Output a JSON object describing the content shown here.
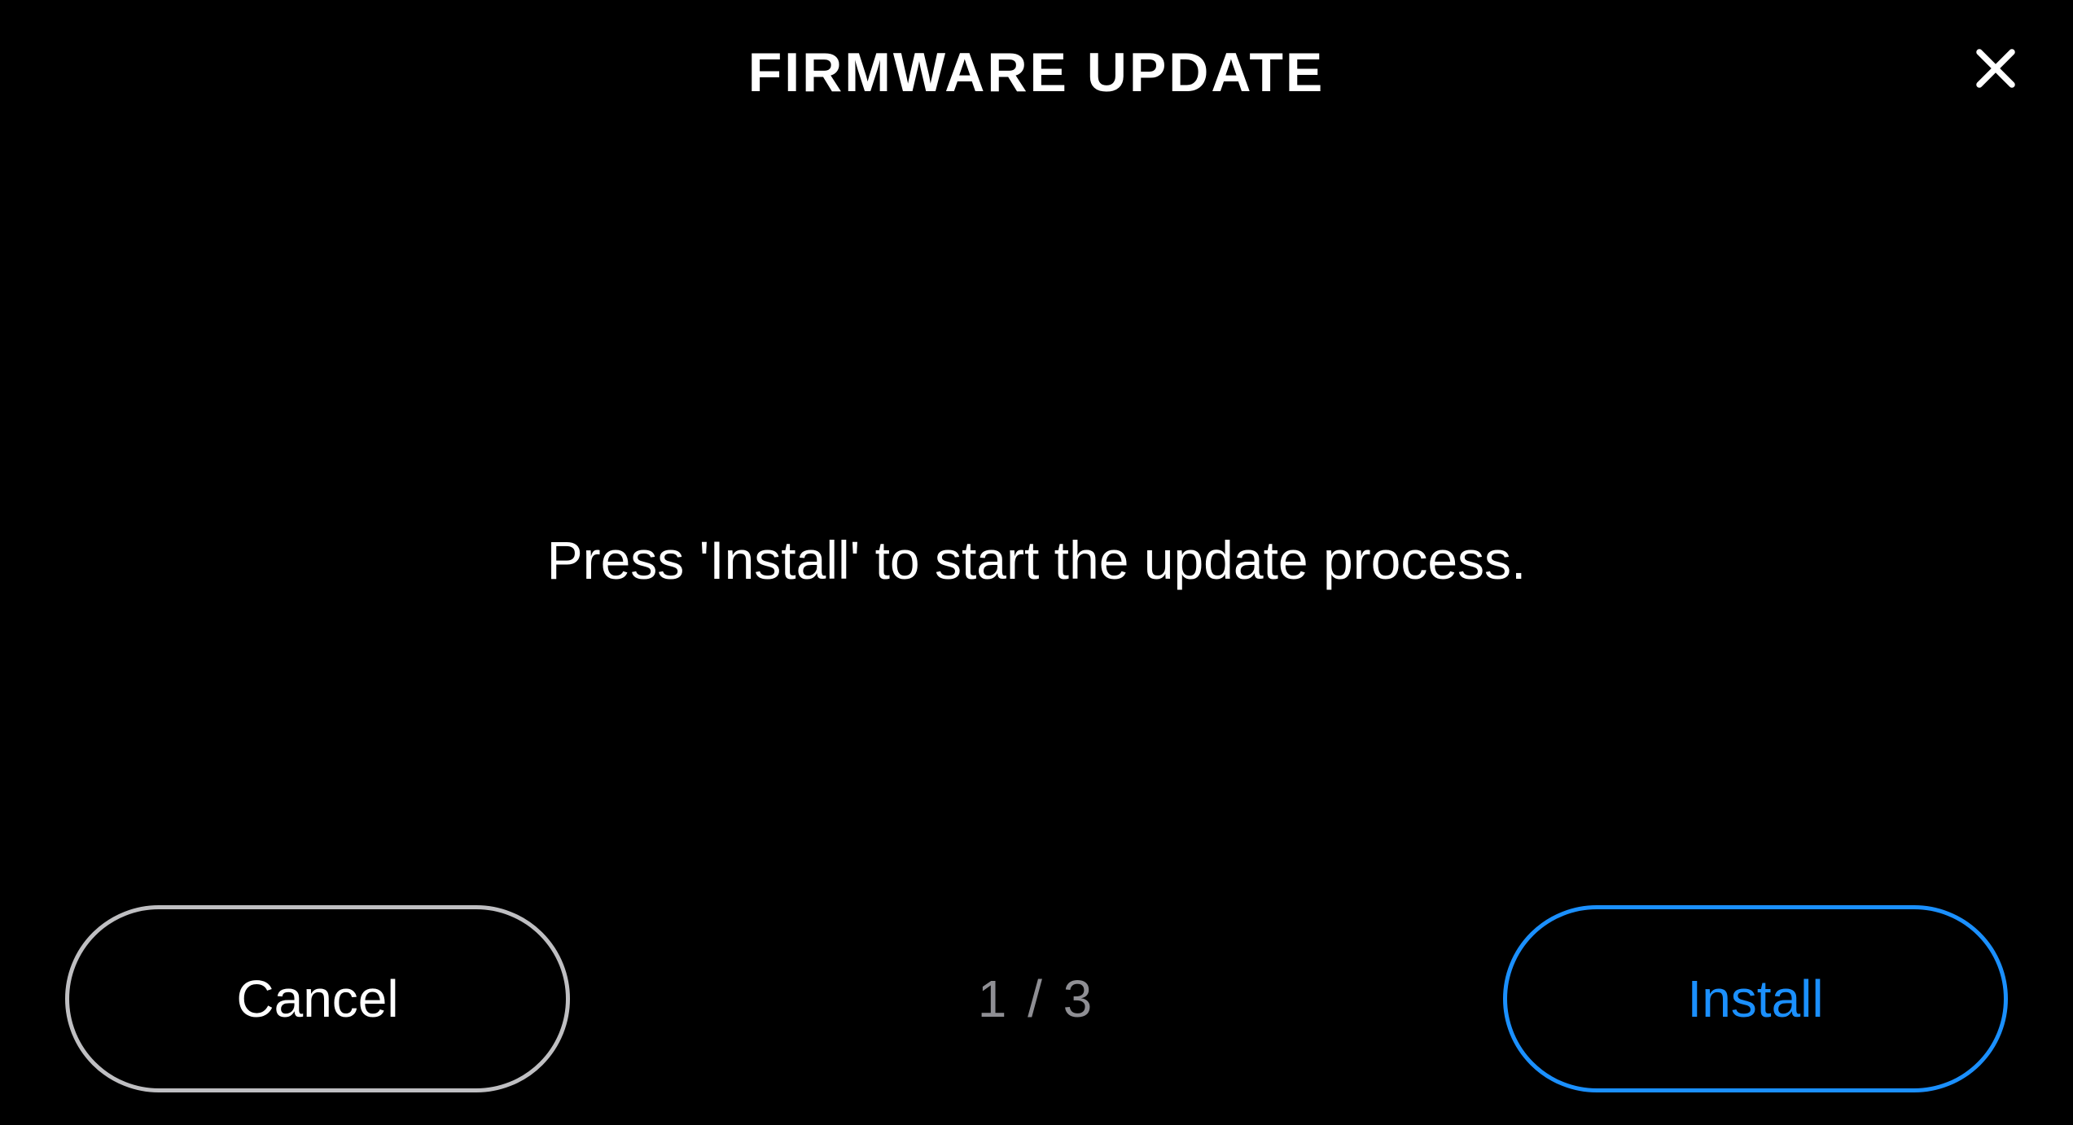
{
  "header": {
    "title": "FIRMWARE UPDATE"
  },
  "body": {
    "message": "Press 'Install' to start the update process."
  },
  "footer": {
    "cancel_label": "Cancel",
    "install_label": "Install",
    "step_indicator": "1 / 3"
  }
}
